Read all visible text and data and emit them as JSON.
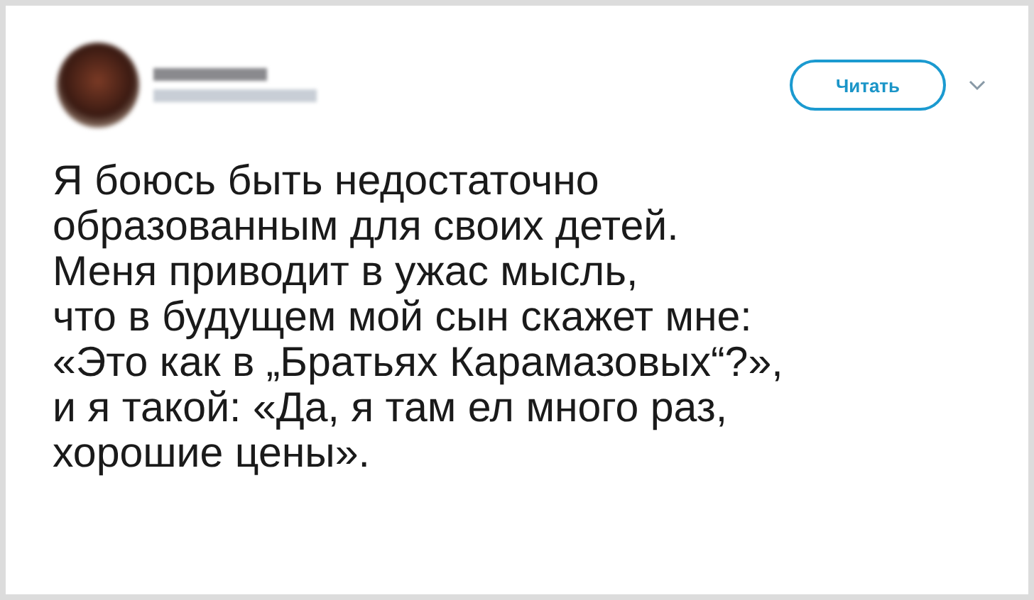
{
  "header": {
    "follow_button": "Читать"
  },
  "tweet": {
    "text": "Я боюсь быть недостаточно\nобразованным для своих детей.\nМеня приводит в ужас мысль,\nчто в будущем мой сын скажет мне:\n«Это как в „Братьях Карамазовых“?»,\nи я такой: «Да, я там ел много раз,\nхорошие цены»."
  }
}
